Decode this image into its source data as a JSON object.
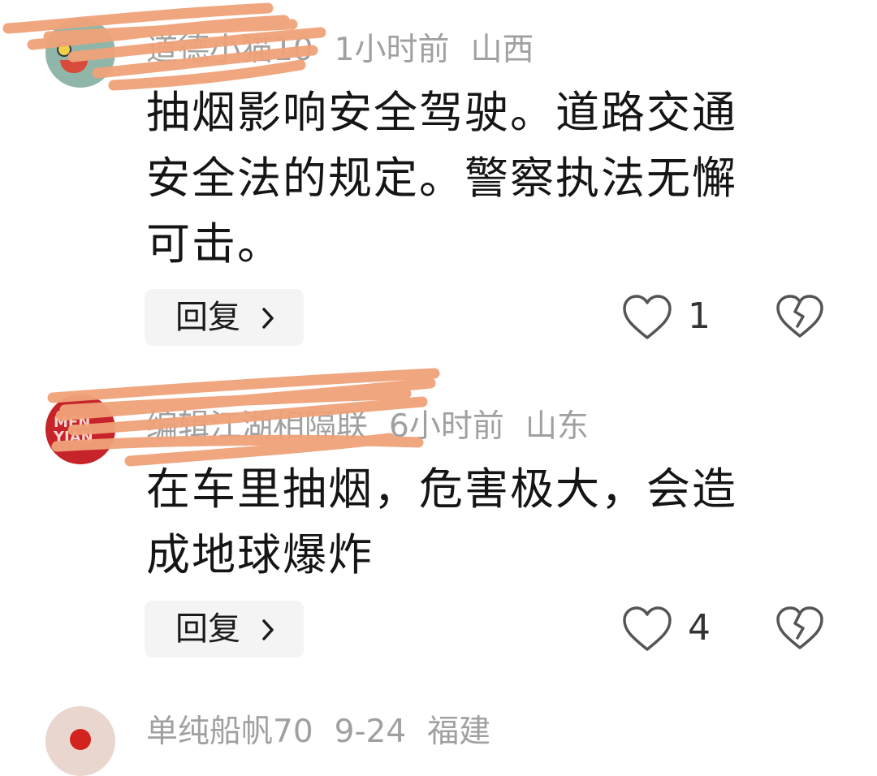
{
  "comments": [
    {
      "username": "道德小猫10",
      "time": "1小时前",
      "location": "山西",
      "text_lines": [
        "抽烟影响安全驾驶。道路交通",
        "安全法的规定。警察执法无懈",
        "可击。"
      ],
      "reply_label": "回复",
      "likes": "1"
    },
    {
      "username": "编辑江湖相隔联",
      "time": "6小时前",
      "location": "山东",
      "text_lines": [
        "在车里抽烟，危害极大，会造",
        "成地球爆炸"
      ],
      "reply_label": "回复",
      "likes": "4"
    },
    {
      "username": "单纯船帆70",
      "time": "9-24",
      "location": "福建"
    }
  ],
  "icons": {
    "like": "heart-outline-icon",
    "dislike": "broken-heart-icon",
    "reply_arrow": "chevron-right-icon"
  },
  "colors": {
    "redaction": "#f0a37a",
    "meta_text": "#a0a0a0",
    "reply_bg": "#f4f4f4"
  }
}
